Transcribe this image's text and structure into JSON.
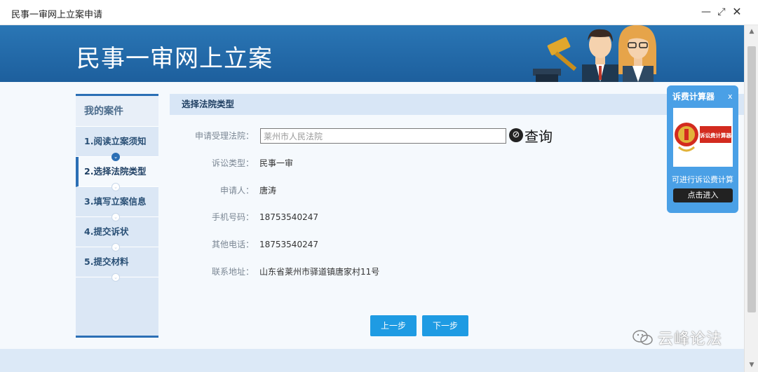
{
  "window": {
    "title": "民事一审网上立案申请",
    "controls": {
      "minimize": "—",
      "maximize": "⤢",
      "close": "✕"
    }
  },
  "banner": {
    "title": "民事一审网上立案"
  },
  "sidebar": {
    "heading": "我的案件",
    "steps": [
      {
        "label": "1.阅读立案须知"
      },
      {
        "label": "2.选择法院类型"
      },
      {
        "label": "3.填写立案信息"
      },
      {
        "label": "4.提交诉状"
      },
      {
        "label": "5.提交材料"
      }
    ]
  },
  "panel": {
    "heading": "选择法院类型",
    "court": {
      "label": "申请受理法院：",
      "value": "莱州市人民法院",
      "query_label": "查询"
    },
    "fields": [
      {
        "label": "诉讼类型：",
        "value": "民事一审"
      },
      {
        "label": "申请人：",
        "value": "唐涛"
      },
      {
        "label": "手机号码：",
        "value": "18753540247"
      },
      {
        "label": "其他电话：",
        "value": "18753540247"
      },
      {
        "label": "联系地址：",
        "value": "山东省莱州市驿道镇唐家村11号"
      }
    ],
    "prev_label": "上一步",
    "next_label": "下一步"
  },
  "calculator": {
    "title": "诉费计算器",
    "close": "x",
    "image_text": "诉讼费计算器",
    "description": "可进行诉讼费计算",
    "enter_label": "点击进入"
  },
  "watermark": {
    "text": "云峰论法"
  },
  "colors": {
    "banner": "#1d5f9d",
    "accent": "#2b6fb5",
    "button": "#1e9be3",
    "widget": "#4aa0e6"
  }
}
